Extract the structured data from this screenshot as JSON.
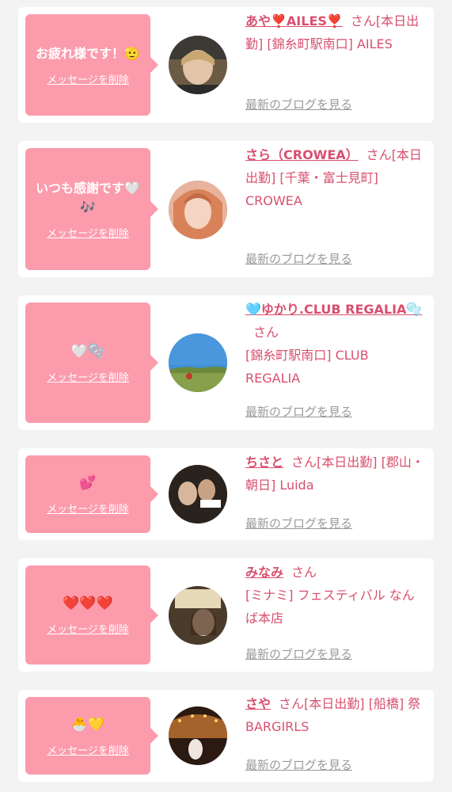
{
  "common": {
    "delete_label": "メッセージを削除",
    "blog_label": "最新のブログを見る"
  },
  "colors": {
    "bubble": "#fc9bac",
    "accent": "#d8506e",
    "muted": "#9a9a9a",
    "page_bg": "#f3f3f3"
  },
  "cards": [
    {
      "message": "お疲れ様です！🫡",
      "name": "あや❣️AILES❣️",
      "honorific": "さん",
      "details": "[本日出勤] [錦糸町駅南口] AILES"
    },
    {
      "message": "いつも感謝です🤍🎶",
      "name": "さら（CROWEA）",
      "honorific": "さん",
      "details": "[本日出勤] [千葉・富士見町] CROWEA"
    },
    {
      "message": "🤍🫧",
      "name": "🩵ゆかり.CLUB REGALIA🫧",
      "honorific": "さん",
      "details": "[錦糸町駅南口] CLUB REGALIA"
    },
    {
      "message": "💕",
      "name": "ちさと",
      "honorific": "さん",
      "details": "[本日出勤] [郡山・朝日] Luida"
    },
    {
      "message": "❤️❤️❤️",
      "name": "みなみ",
      "honorific": "さん",
      "details": "[ミナミ] フェスティバル なんば本店"
    },
    {
      "message": "🐣💛",
      "name": "さや",
      "honorific": "さん",
      "details": "[本日出勤] [船橋] 祭BARGIRLS"
    }
  ]
}
